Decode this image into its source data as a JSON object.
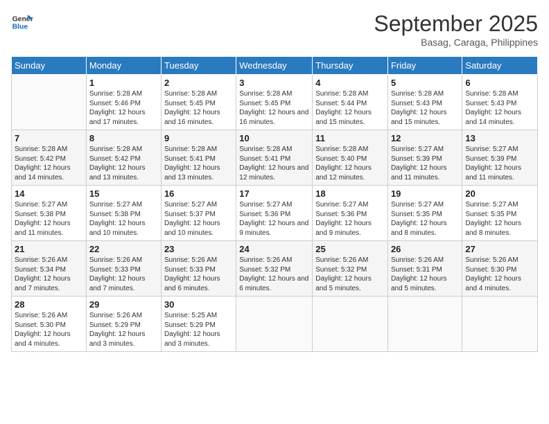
{
  "logo": {
    "line1": "General",
    "line2": "Blue"
  },
  "title": "September 2025",
  "subtitle": "Basag, Caraga, Philippines",
  "days_of_week": [
    "Sunday",
    "Monday",
    "Tuesday",
    "Wednesday",
    "Thursday",
    "Friday",
    "Saturday"
  ],
  "weeks": [
    [
      {
        "num": "",
        "sunrise": "",
        "sunset": "",
        "daylight": ""
      },
      {
        "num": "1",
        "sunrise": "5:28 AM",
        "sunset": "5:46 PM",
        "daylight": "12 hours and 17 minutes."
      },
      {
        "num": "2",
        "sunrise": "5:28 AM",
        "sunset": "5:45 PM",
        "daylight": "12 hours and 16 minutes."
      },
      {
        "num": "3",
        "sunrise": "5:28 AM",
        "sunset": "5:45 PM",
        "daylight": "12 hours and 16 minutes."
      },
      {
        "num": "4",
        "sunrise": "5:28 AM",
        "sunset": "5:44 PM",
        "daylight": "12 hours and 15 minutes."
      },
      {
        "num": "5",
        "sunrise": "5:28 AM",
        "sunset": "5:43 PM",
        "daylight": "12 hours and 15 minutes."
      },
      {
        "num": "6",
        "sunrise": "5:28 AM",
        "sunset": "5:43 PM",
        "daylight": "12 hours and 14 minutes."
      }
    ],
    [
      {
        "num": "7",
        "sunrise": "5:28 AM",
        "sunset": "5:42 PM",
        "daylight": "12 hours and 14 minutes."
      },
      {
        "num": "8",
        "sunrise": "5:28 AM",
        "sunset": "5:42 PM",
        "daylight": "12 hours and 13 minutes."
      },
      {
        "num": "9",
        "sunrise": "5:28 AM",
        "sunset": "5:41 PM",
        "daylight": "12 hours and 13 minutes."
      },
      {
        "num": "10",
        "sunrise": "5:28 AM",
        "sunset": "5:41 PM",
        "daylight": "12 hours and 12 minutes."
      },
      {
        "num": "11",
        "sunrise": "5:28 AM",
        "sunset": "5:40 PM",
        "daylight": "12 hours and 12 minutes."
      },
      {
        "num": "12",
        "sunrise": "5:27 AM",
        "sunset": "5:39 PM",
        "daylight": "12 hours and 11 minutes."
      },
      {
        "num": "13",
        "sunrise": "5:27 AM",
        "sunset": "5:39 PM",
        "daylight": "12 hours and 11 minutes."
      }
    ],
    [
      {
        "num": "14",
        "sunrise": "5:27 AM",
        "sunset": "5:38 PM",
        "daylight": "12 hours and 11 minutes."
      },
      {
        "num": "15",
        "sunrise": "5:27 AM",
        "sunset": "5:38 PM",
        "daylight": "12 hours and 10 minutes."
      },
      {
        "num": "16",
        "sunrise": "5:27 AM",
        "sunset": "5:37 PM",
        "daylight": "12 hours and 10 minutes."
      },
      {
        "num": "17",
        "sunrise": "5:27 AM",
        "sunset": "5:36 PM",
        "daylight": "12 hours and 9 minutes."
      },
      {
        "num": "18",
        "sunrise": "5:27 AM",
        "sunset": "5:36 PM",
        "daylight": "12 hours and 9 minutes."
      },
      {
        "num": "19",
        "sunrise": "5:27 AM",
        "sunset": "5:35 PM",
        "daylight": "12 hours and 8 minutes."
      },
      {
        "num": "20",
        "sunrise": "5:27 AM",
        "sunset": "5:35 PM",
        "daylight": "12 hours and 8 minutes."
      }
    ],
    [
      {
        "num": "21",
        "sunrise": "5:26 AM",
        "sunset": "5:34 PM",
        "daylight": "12 hours and 7 minutes."
      },
      {
        "num": "22",
        "sunrise": "5:26 AM",
        "sunset": "5:33 PM",
        "daylight": "12 hours and 7 minutes."
      },
      {
        "num": "23",
        "sunrise": "5:26 AM",
        "sunset": "5:33 PM",
        "daylight": "12 hours and 6 minutes."
      },
      {
        "num": "24",
        "sunrise": "5:26 AM",
        "sunset": "5:32 PM",
        "daylight": "12 hours and 6 minutes."
      },
      {
        "num": "25",
        "sunrise": "5:26 AM",
        "sunset": "5:32 PM",
        "daylight": "12 hours and 5 minutes."
      },
      {
        "num": "26",
        "sunrise": "5:26 AM",
        "sunset": "5:31 PM",
        "daylight": "12 hours and 5 minutes."
      },
      {
        "num": "27",
        "sunrise": "5:26 AM",
        "sunset": "5:30 PM",
        "daylight": "12 hours and 4 minutes."
      }
    ],
    [
      {
        "num": "28",
        "sunrise": "5:26 AM",
        "sunset": "5:30 PM",
        "daylight": "12 hours and 4 minutes."
      },
      {
        "num": "29",
        "sunrise": "5:26 AM",
        "sunset": "5:29 PM",
        "daylight": "12 hours and 3 minutes."
      },
      {
        "num": "30",
        "sunrise": "5:25 AM",
        "sunset": "5:29 PM",
        "daylight": "12 hours and 3 minutes."
      },
      {
        "num": "",
        "sunrise": "",
        "sunset": "",
        "daylight": ""
      },
      {
        "num": "",
        "sunrise": "",
        "sunset": "",
        "daylight": ""
      },
      {
        "num": "",
        "sunrise": "",
        "sunset": "",
        "daylight": ""
      },
      {
        "num": "",
        "sunrise": "",
        "sunset": "",
        "daylight": ""
      }
    ]
  ]
}
